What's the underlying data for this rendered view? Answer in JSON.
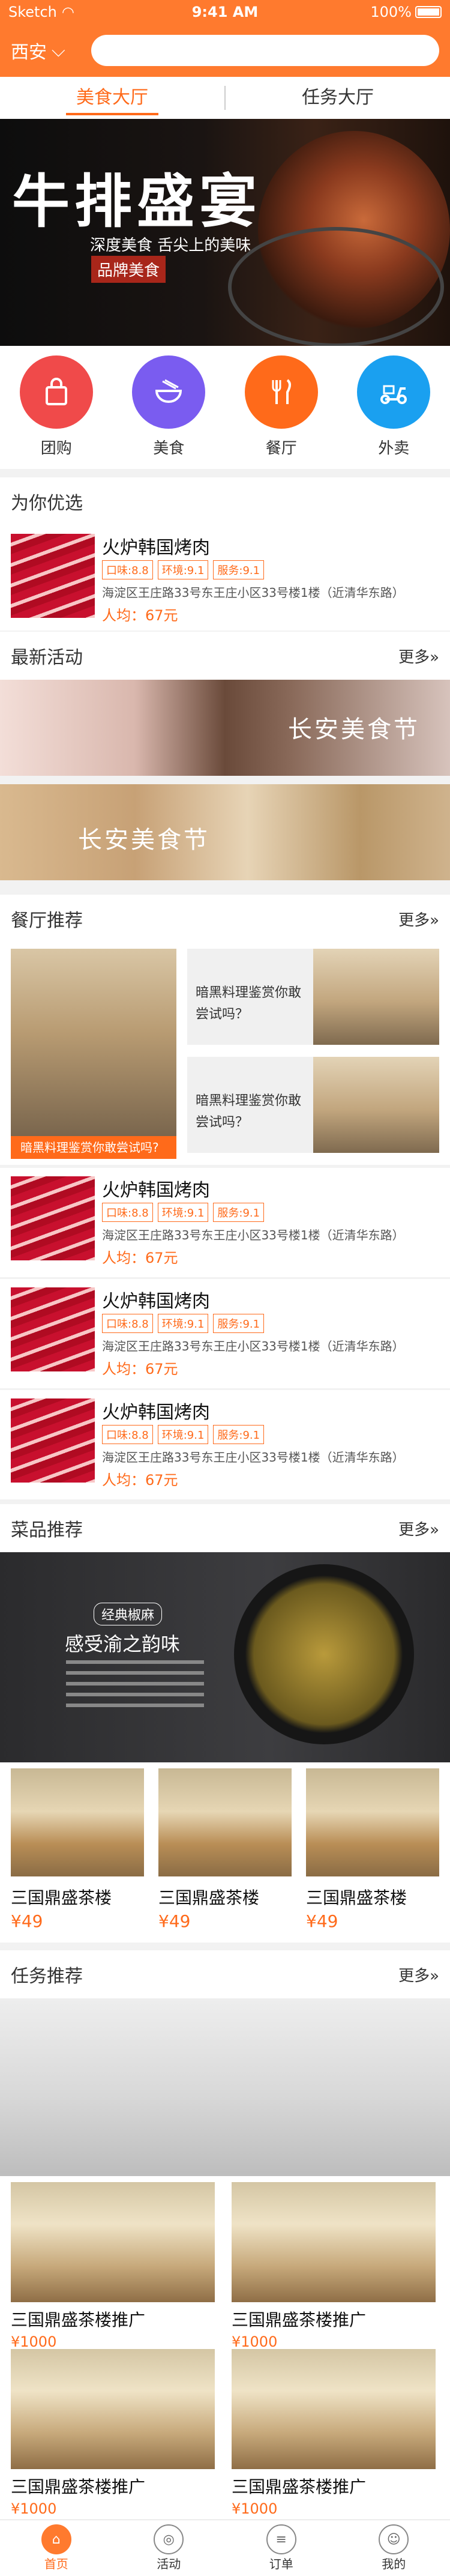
{
  "status": {
    "carrier": "Sketch",
    "time": "9:41 AM",
    "battery": "100%"
  },
  "header": {
    "city": "西安"
  },
  "tabs": [
    {
      "label": "美食大厅"
    },
    {
      "label": "任务大厅"
    }
  ],
  "banner": {
    "title": "牛排盛宴",
    "subtitle": "深度美食 舌尖上的美味",
    "tag": "品牌美食"
  },
  "categories": [
    {
      "label": "团购",
      "icon": "shopping-bag-icon",
      "color": "#f04a4a"
    },
    {
      "label": "美食",
      "icon": "noodle-bowl-icon",
      "color": "#7a5cf0"
    },
    {
      "label": "餐厅",
      "icon": "fork-knife-icon",
      "color": "#ff6a1a"
    },
    {
      "label": "外卖",
      "icon": "scooter-icon",
      "color": "#1aa0f0"
    }
  ],
  "sections": {
    "recommend": "为你优选",
    "activities": "最新活动",
    "restaurants": "餐厅推荐",
    "dishes": "菜品推荐",
    "tasks": "任务推荐",
    "more": "更多»"
  },
  "featured": {
    "name": "火炉韩国烤肉",
    "tags": [
      "口味:8.8",
      "环境:9.1",
      "服务:9.1"
    ],
    "address": "海淀区王庄路33号东王庄小区33号楼1楼（近清华东路）",
    "avg": "人均：67元"
  },
  "activities": [
    {
      "title": "长安美食节"
    },
    {
      "title": "长安美食节"
    }
  ],
  "restaurant_grid": {
    "big_caption": "暗黑料理鉴赏你敢尝试吗?",
    "cards": [
      {
        "text": "暗黑料理鉴赏你敢尝试吗？"
      },
      {
        "text": "暗黑料理鉴赏你敢尝试吗？"
      }
    ]
  },
  "restaurants": [
    {
      "name": "火炉韩国烤肉",
      "tags": [
        "口味:8.8",
        "环境:9.1",
        "服务:9.1"
      ],
      "address": "海淀区王庄路33号东王庄小区33号楼1楼（近清华东路）",
      "avg": "人均：67元"
    },
    {
      "name": "火炉韩国烤肉",
      "tags": [
        "口味:8.8",
        "环境:9.1",
        "服务:9.1"
      ],
      "address": "海淀区王庄路33号东王庄小区33号楼1楼（近清华东路）",
      "avg": "人均：67元"
    },
    {
      "name": "火炉韩国烤肉",
      "tags": [
        "口味:8.8",
        "环境:9.1",
        "服务:9.1"
      ],
      "address": "海淀区王庄路33号东王庄小区33号楼1楼（近清华东路）",
      "avg": "人均：67元"
    }
  ],
  "dish_banner": {
    "badge": "经典椒麻",
    "title": "感受渝之韵味"
  },
  "hotels": [
    {
      "name": "三国鼎盛茶楼",
      "price": "¥49"
    },
    {
      "name": "三国鼎盛茶楼",
      "price": "¥49"
    },
    {
      "name": "三国鼎盛茶楼",
      "price": "¥49"
    }
  ],
  "tasks": [
    {
      "name": "三国鼎盛茶楼推广",
      "price": "¥1000"
    },
    {
      "name": "三国鼎盛茶楼推广",
      "price": "¥1000"
    },
    {
      "name": "三国鼎盛茶楼推广",
      "price": "¥1000"
    },
    {
      "name": "三国鼎盛茶楼推广",
      "price": "¥1000"
    }
  ],
  "tabbar": [
    {
      "label": "首页",
      "icon": "home-icon"
    },
    {
      "label": "活动",
      "icon": "activity-icon"
    },
    {
      "label": "订单",
      "icon": "order-icon"
    },
    {
      "label": "我的",
      "icon": "profile-icon"
    }
  ],
  "colors": {
    "accent": "#ff6a1a",
    "header": "#ff7a2e"
  }
}
